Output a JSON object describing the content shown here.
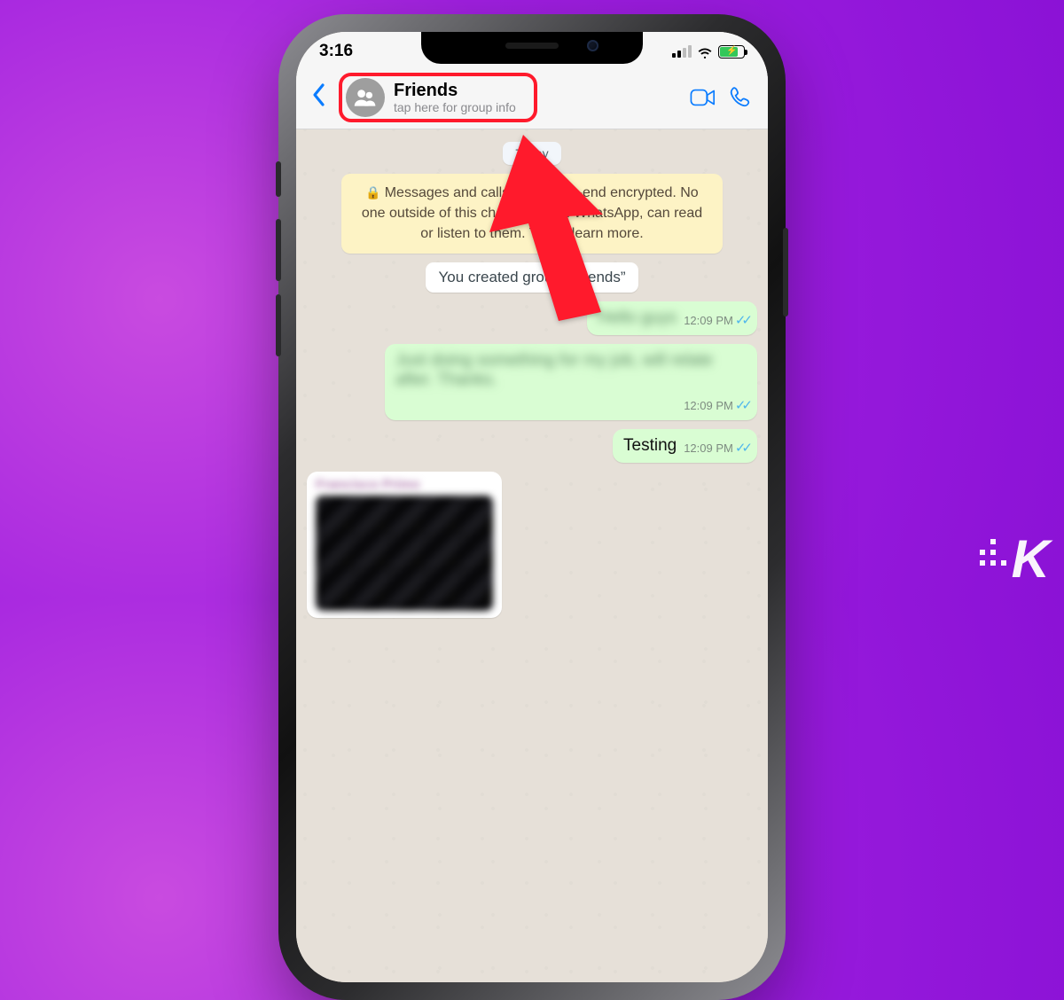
{
  "status": {
    "time": "3:16"
  },
  "header": {
    "chat_title": "Friends",
    "chat_subtitle": "tap here for group info"
  },
  "banner": {
    "date_chip": "Today",
    "encryption_text": "Messages and calls are end-to-end encrypted. No one outside of this chat, not even WhatsApp, can read or listen to them. Tap to learn more.",
    "system_message": "You created group “Friends”"
  },
  "messages": {
    "out1_text": "Hello guys",
    "out1_time": "12:09 PM",
    "out2_text": "Just doing something for my job, will relate after. Thanks.",
    "out2_time": "12:09 PM",
    "out3_text": "Testing",
    "out3_time": "12:09 PM",
    "in1_sender": "Francisco Primo"
  },
  "colors": {
    "accent_blue": "#0a7cff",
    "highlight_red": "#ff1a2c",
    "bubble_out": "#d9fdd3"
  }
}
